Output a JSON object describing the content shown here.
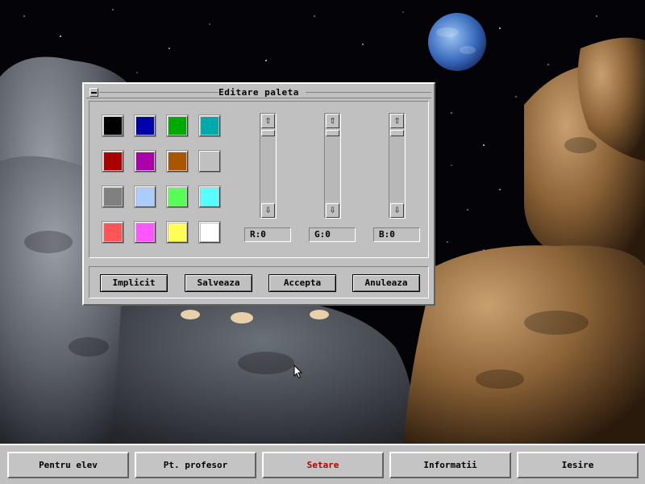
{
  "dialog": {
    "title": "Editare paleta",
    "swatches": [
      {
        "color": "#000000"
      },
      {
        "color": "#0000aa"
      },
      {
        "color": "#00aa00"
      },
      {
        "color": "#00aaaa"
      },
      {
        "color": "#aa0000"
      },
      {
        "color": "#aa00aa"
      },
      {
        "color": "#aa5500"
      },
      {
        "color": "#c0c0c0"
      },
      {
        "color": "#808080"
      },
      {
        "color": "#aaccff"
      },
      {
        "color": "#55ff55"
      },
      {
        "color": "#55ffff"
      },
      {
        "color": "#ff5555"
      },
      {
        "color": "#ff55ff"
      },
      {
        "color": "#ffff55"
      },
      {
        "color": "#ffffff"
      }
    ],
    "channels": [
      {
        "label": "R:0",
        "value": 0,
        "up_icon": "arrow-up-icon",
        "down_icon": "arrow-down-icon"
      },
      {
        "label": "G:0",
        "value": 0,
        "up_icon": "arrow-up-icon",
        "down_icon": "arrow-down-icon"
      },
      {
        "label": "B:0",
        "value": 0,
        "up_icon": "arrow-up-icon",
        "down_icon": "arrow-down-icon"
      }
    ],
    "buttons": {
      "default": "Implicit",
      "save": "Salveaza",
      "accept": "Accepta",
      "cancel": "Anuleaza"
    }
  },
  "taskbar": {
    "items": [
      {
        "label": "Pentru elev"
      },
      {
        "label": "Pt. profesor"
      },
      {
        "label": "Setare",
        "active": true
      },
      {
        "label": "Informatii"
      },
      {
        "label": "Iesire"
      }
    ],
    "active_color": "#b00000"
  }
}
